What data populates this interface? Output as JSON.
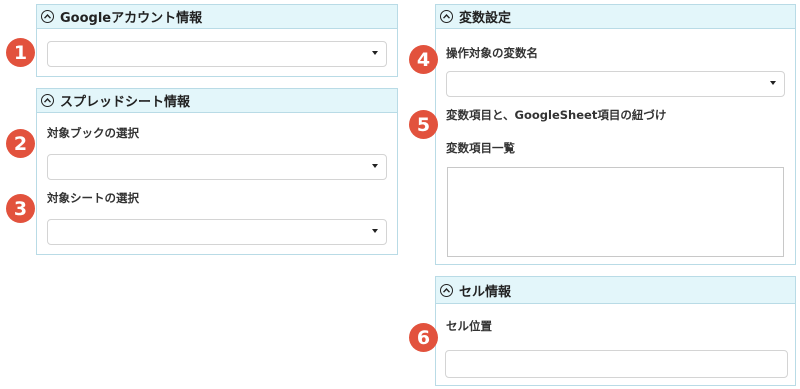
{
  "panels": {
    "google_account": {
      "title": "Googleアカウント情報",
      "account_select_value": ""
    },
    "spreadsheet": {
      "title": "スプレッドシート情報",
      "book_label": "対象ブックの選択",
      "book_select_value": "",
      "sheet_label": "対象シートの選択",
      "sheet_select_value": ""
    },
    "variable": {
      "title": "変数設定",
      "target_label": "操作対象の変数名",
      "target_select_value": "",
      "mapping_label": "変数項目と、GoogleSheet項目の紐づけ",
      "list_label": "変数項目一覧",
      "list_items": []
    },
    "cell": {
      "title": "セル情報",
      "position_label": "セル位置",
      "position_value": ""
    }
  },
  "badges": [
    "1",
    "2",
    "3",
    "4",
    "5",
    "6"
  ],
  "colors": {
    "header_bg": "#e3f6fa",
    "panel_border": "#b9dbe6",
    "badge": "#e2523d"
  }
}
